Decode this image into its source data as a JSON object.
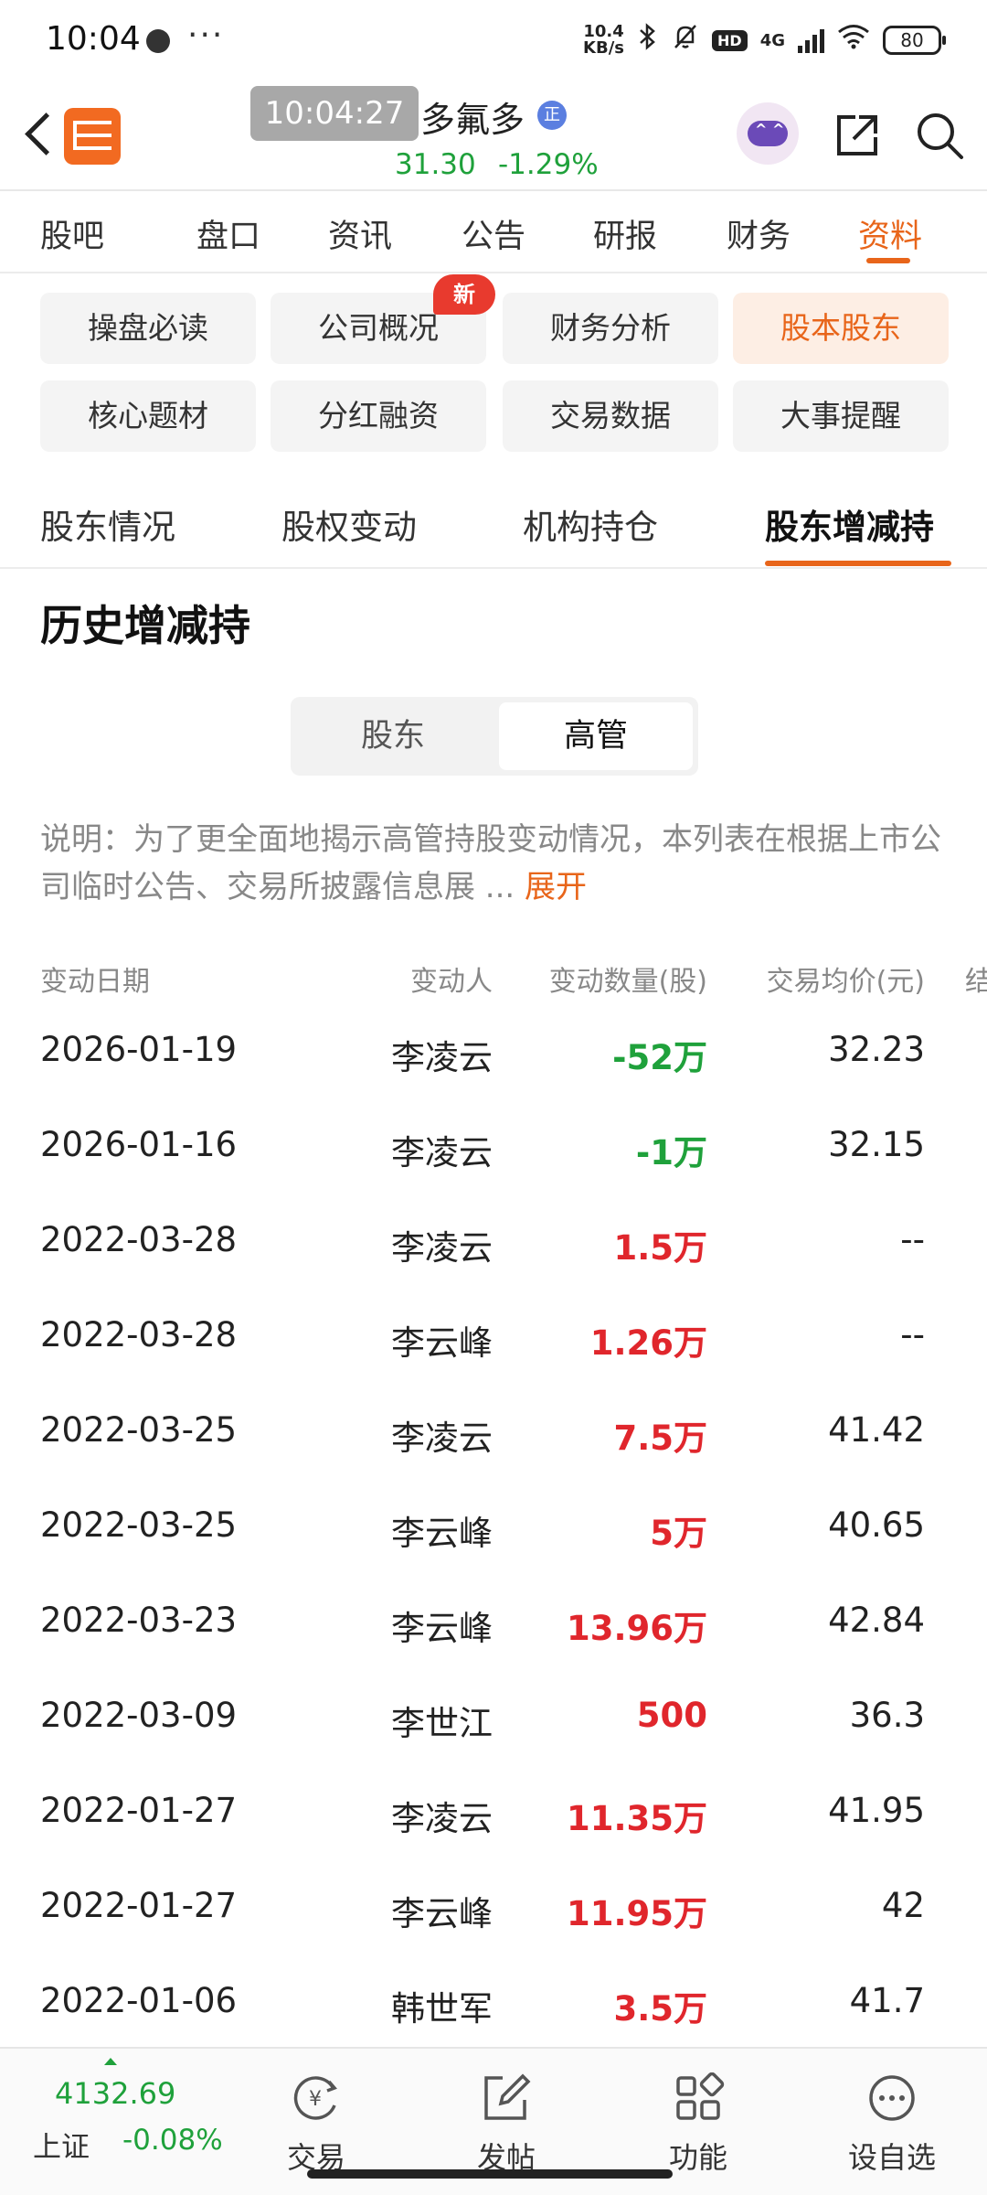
{
  "status_bar": {
    "time": "10:04",
    "net_speed_value": "10.4",
    "net_speed_unit": "KB/s",
    "network": "4G",
    "battery": "80"
  },
  "header": {
    "time_overlay": "10:04:27",
    "stock_name": "多氟多",
    "badge": "正",
    "price": "31.30",
    "change": "-1.29%",
    "brand_logo_text": "东方财富"
  },
  "main_tabs": [
    "股吧",
    "盘口",
    "资讯",
    "公告",
    "研报",
    "财务",
    "资料"
  ],
  "categories": [
    {
      "label": "操盘必读"
    },
    {
      "label": "公司概况"
    },
    {
      "label": "财务分析"
    },
    {
      "label": "股本股东"
    },
    {
      "label": "核心题材"
    },
    {
      "label": "分红融资"
    },
    {
      "label": "交易数据"
    },
    {
      "label": "大事提醒"
    }
  ],
  "new_badge": "新",
  "sub_tabs": [
    "股东情况",
    "股权变动",
    "机构持仓",
    "股东增减持"
  ],
  "section_title": "历史增减持",
  "segment": {
    "left": "股东",
    "right": "高管"
  },
  "description": {
    "text": "说明：为了更全面地揭示高管持股变动情况，本列表在根据上市公司临时公告、交易所披露信息展 ...",
    "expand": "展开"
  },
  "table": {
    "headers": [
      "变动日期",
      "变动人",
      "变动数量(股)",
      "交易均价(元)",
      "结"
    ],
    "rows": [
      {
        "date": "2026-01-19",
        "person": "李凌云",
        "qty": "-52万",
        "price": "32.23",
        "dir": "neg"
      },
      {
        "date": "2026-01-16",
        "person": "李凌云",
        "qty": "-1万",
        "price": "32.15",
        "dir": "neg"
      },
      {
        "date": "2022-03-28",
        "person": "李凌云",
        "qty": "1.5万",
        "price": "--",
        "dir": "pos"
      },
      {
        "date": "2022-03-28",
        "person": "李云峰",
        "qty": "1.26万",
        "price": "--",
        "dir": "pos"
      },
      {
        "date": "2022-03-25",
        "person": "李凌云",
        "qty": "7.5万",
        "price": "41.42",
        "dir": "pos"
      },
      {
        "date": "2022-03-25",
        "person": "李云峰",
        "qty": "5万",
        "price": "40.65",
        "dir": "pos"
      },
      {
        "date": "2022-03-23",
        "person": "李云峰",
        "qty": "13.96万",
        "price": "42.84",
        "dir": "pos"
      },
      {
        "date": "2022-03-09",
        "person": "李世江",
        "qty": "500",
        "price": "36.3",
        "dir": "pos"
      },
      {
        "date": "2022-01-27",
        "person": "李凌云",
        "qty": "11.35万",
        "price": "41.95",
        "dir": "pos"
      },
      {
        "date": "2022-01-27",
        "person": "李云峰",
        "qty": "11.95万",
        "price": "42",
        "dir": "pos"
      },
      {
        "date": "2022-01-06",
        "person": "韩世军",
        "qty": "3.5万",
        "price": "41.7",
        "dir": "pos"
      }
    ]
  },
  "bottom_bar": {
    "index_value": "4132.69",
    "index_name": "上证",
    "index_change": "-0.08%",
    "nav": [
      "交易",
      "发帖",
      "功能",
      "设自选"
    ]
  },
  "colors": {
    "accent": "#e8651a",
    "up": "#e0262c",
    "down": "#1fa13b"
  }
}
